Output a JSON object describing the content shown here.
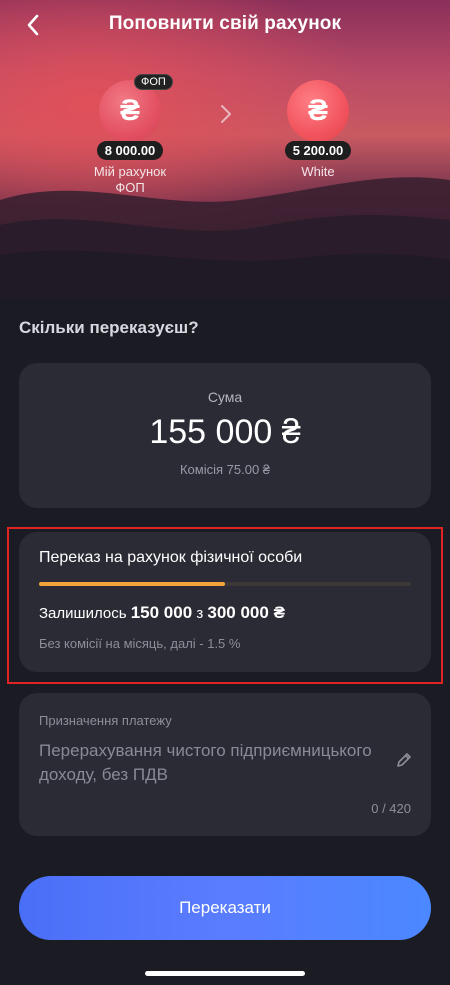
{
  "header": {
    "title": "Поповнити свій рахунок"
  },
  "from_account": {
    "badge": "ФОП",
    "symbol": "₴",
    "amount": "8 000.00",
    "label": "Мій рахунок ФОП"
  },
  "to_account": {
    "symbol": "₴",
    "amount": "5 200.00",
    "label": "White"
  },
  "question": "Скільки переказуєш?",
  "sum": {
    "label": "Сума",
    "value": "155 000 ₴",
    "fee": "Комісія 75.00 ₴"
  },
  "limit": {
    "title": "Переказ на рахунок фізичної особи",
    "remaining_prefix": "Залишилось",
    "remaining_amount": "150 000",
    "remaining_mid": "з",
    "total_amount": "300 000 ₴",
    "progress_fraction": 0.5,
    "note": "Без комісії на місяць, далі - 1.5 %"
  },
  "purpose": {
    "label": "Призначення платежу",
    "text": "Перерахування чистого підприємницького доходу, без ПДВ",
    "counter": "0 / 420"
  },
  "submit": {
    "label": "Переказати"
  },
  "colors": {
    "accent_blue": "#4a6ff7",
    "progress_orange": "#f0a43a",
    "highlight_red": "#e02424",
    "background": "#1b1b23",
    "card": "#2b2b35"
  },
  "icons": {
    "back": "chevron-left-icon",
    "transfer_arrow": "chevron-right-icon",
    "edit": "pencil-icon"
  }
}
